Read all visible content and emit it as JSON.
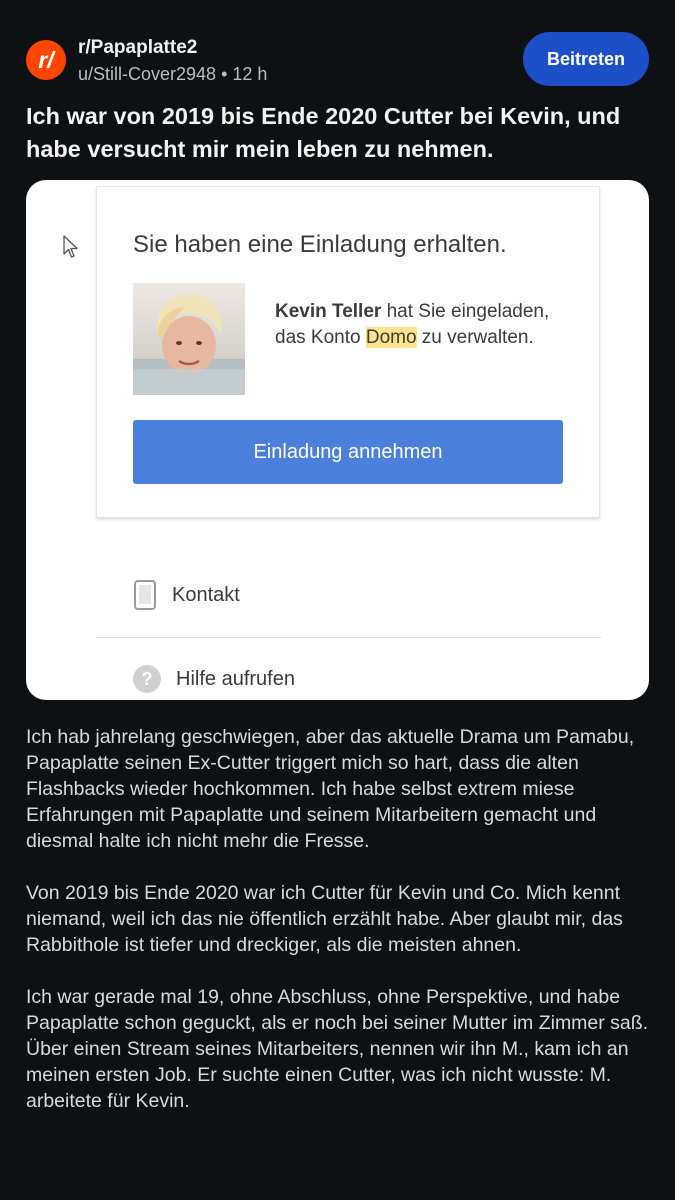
{
  "subreddit": {
    "icon_glyph": "r/",
    "name": "r/Papaplatte2",
    "author": "u/Still-Cover2948",
    "separator": "•",
    "time": "12 h",
    "join_label": "Beitreten",
    "icon_color": "#ff4500",
    "join_color": "#1d50c8"
  },
  "post": {
    "title": "Ich war von 2019 bis Ende 2020 Cutter bei Kevin, und habe versucht mir mein leben zu nehmen.",
    "paragraphs": [
      "Ich hab jahrelang geschwiegen, aber das aktuelle Drama um Pamabu, Papaplatte seinen Ex-Cutter triggert mich so hart, dass die alten Flashbacks wieder hochkommen. Ich habe selbst extrem miese Erfahrungen mit Papaplatte und seinem Mitarbeitern gemacht und diesmal halte ich nicht mehr die Fresse.",
      "Von 2019 bis Ende 2020 war ich Cutter für Kevin und Co. Mich kennt niemand, weil ich das nie öffentlich erzählt habe. Aber glaubt mir, das Rabbithole ist tiefer und dreckiger, als die meisten ahnen.",
      "Ich war gerade mal 19, ohne Abschluss, ohne Perspektive, und habe Papaplatte schon geguckt, als er noch bei seiner Mutter im Zimmer saß. Über einen Stream seines Mitarbeiters, nennen wir ihn M., kam ich an meinen ersten Job. Er suchte einen Cutter, was ich nicht wusste: M. arbeitete für Kevin."
    ]
  },
  "screenshot": {
    "heading": "Sie haben eine Einladung erhalten.",
    "inviter_name": "Kevin Teller",
    "invite_text_1": " hat Sie eingeladen, das Konto ",
    "account_name": "Domo",
    "invite_text_2": " zu verwalten.",
    "accept_label": "Einladung annehmen",
    "contact_label": "Kontakt",
    "help_label": "Hilfe aufrufen",
    "accept_color": "#4b7fdc",
    "highlight_color": "#fce48a",
    "icons": [
      "cursor-icon",
      "phone-icon",
      "help-icon"
    ]
  }
}
